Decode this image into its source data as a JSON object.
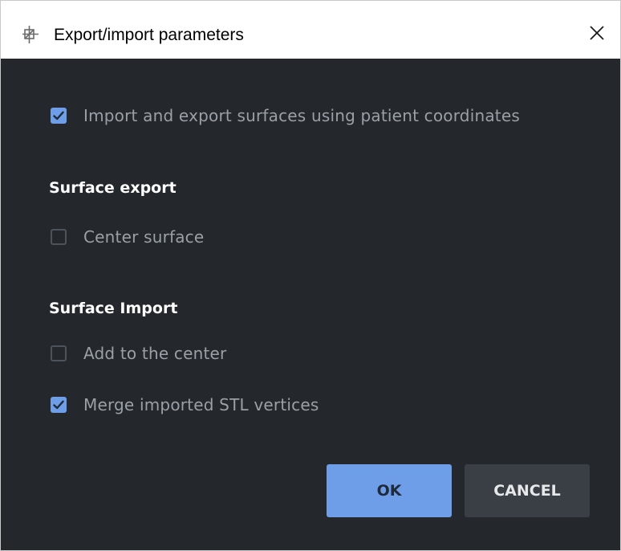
{
  "window": {
    "title": "Export/import parameters",
    "icon": "app-icon",
    "close_icon": "close-icon"
  },
  "options": {
    "patient_coordinates": {
      "label": "Import and export surfaces using patient coordinates",
      "checked": true
    }
  },
  "surface_export": {
    "title": "Surface export",
    "center_surface": {
      "label": "Center surface",
      "checked": false
    }
  },
  "surface_import": {
    "title": "Surface Import",
    "add_to_center": {
      "label": "Add to the center",
      "checked": false
    },
    "merge_stl_vertices": {
      "label": "Merge imported STL vertices",
      "checked": true
    }
  },
  "buttons": {
    "ok_label": "OK",
    "cancel_label": "CANCEL"
  },
  "colors": {
    "background": "#24282d",
    "accent": "#6f9ee8",
    "cancel_bg": "#3a3f46",
    "label_text": "#9aa0a6",
    "section_title": "#ffffff"
  }
}
